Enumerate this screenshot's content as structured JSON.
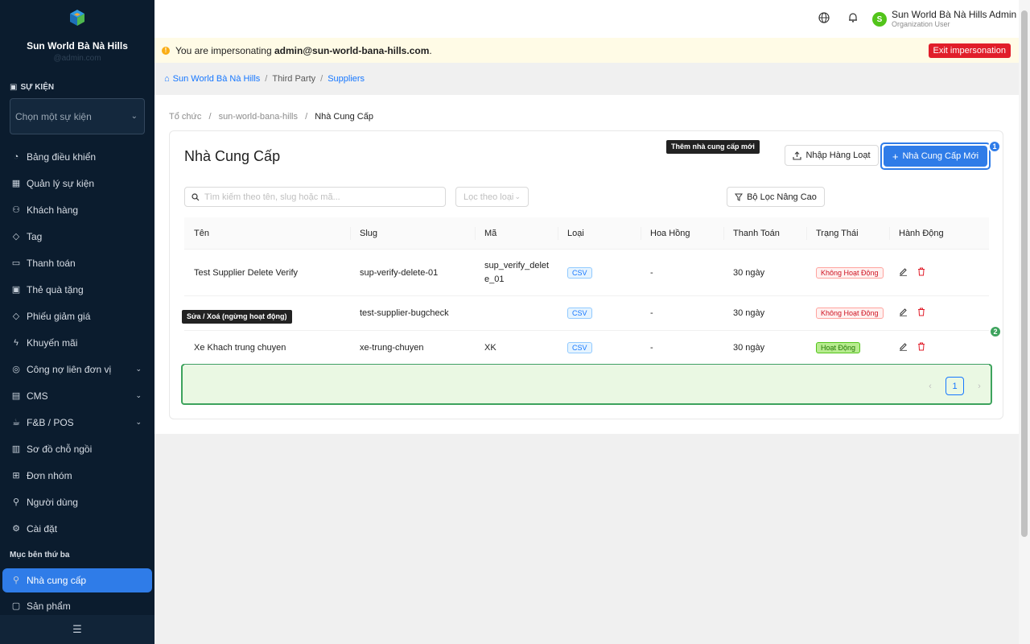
{
  "sidebar": {
    "brand_name": "Sun World Bà Nà Hills",
    "brand_sub": "@admin.com",
    "event_section": "SỰ KIỆN",
    "event_select": "Chọn một sự kiện",
    "items": [
      {
        "label": "Bảng điều khiển",
        "icon": "dashboard-icon",
        "glyph": "◔"
      },
      {
        "label": "Quản lý sự kiện",
        "icon": "calendar-icon",
        "glyph": "▦"
      },
      {
        "label": "Khách hàng",
        "icon": "users-icon",
        "glyph": "⚇"
      },
      {
        "label": "Tag",
        "icon": "tag-icon",
        "glyph": "◇"
      },
      {
        "label": "Thanh toán",
        "icon": "payment-icon",
        "glyph": "▭"
      },
      {
        "label": "Thẻ quà tặng",
        "icon": "gift-icon",
        "glyph": "▣"
      },
      {
        "label": "Phiếu giảm giá",
        "icon": "coupon-icon",
        "glyph": "◇"
      },
      {
        "label": "Khuyến mãi",
        "icon": "promotion-icon",
        "glyph": "ϟ"
      },
      {
        "label": "Công nợ liên đơn vị",
        "icon": "debt-icon",
        "glyph": "◎",
        "chevron": "⌄"
      },
      {
        "label": "CMS",
        "icon": "cms-icon",
        "glyph": "▤",
        "chevron": "⌄"
      },
      {
        "label": "F&B / POS",
        "icon": "fnb-icon",
        "glyph": "☕",
        "chevron": "⌄"
      },
      {
        "label": "Sơ đồ chỗ ngồi",
        "icon": "seatmap-icon",
        "glyph": "▥"
      },
      {
        "label": "Đơn nhóm",
        "icon": "group-order-icon",
        "glyph": "⊞"
      },
      {
        "label": "Người dùng",
        "icon": "user-icon",
        "glyph": "⚲"
      },
      {
        "label": "Cài đặt",
        "icon": "settings-icon",
        "glyph": "⚙"
      }
    ],
    "third_party_section": "Mục bên thứ ba",
    "third_party_items": [
      {
        "label": "Nhà cung cấp",
        "icon": "supplier-icon",
        "glyph": "⚲",
        "active": true
      },
      {
        "label": "Sản phẩm",
        "icon": "product-icon",
        "glyph": "▢"
      }
    ],
    "collapse_icon": "☰"
  },
  "header": {
    "user_name": "Sun World Bà Nà Hills Admin",
    "user_role": "Organization User",
    "avatar_letter": "S"
  },
  "impersonation": {
    "prefix": "You are impersonating",
    "email": "admin@sun-world-bana-hills.com",
    "suffix": ".",
    "exit_label": "Exit impersonation"
  },
  "top_breadcrumb": {
    "home": "Sun World Bà Nà Hills",
    "middle": "Third Party",
    "current": "Suppliers"
  },
  "page_breadcrumb": {
    "org": "Tổ chức",
    "slug": "sun-world-bana-hills",
    "current": "Nhà Cung Cấp"
  },
  "card": {
    "title": "Nhà Cung Cấp",
    "import_label": "Nhập Hàng Loạt",
    "new_label": "Nhà Cung Cấp Mới",
    "search_placeholder": "Tìm kiếm theo tên, slug hoặc mã...",
    "type_filter_placeholder": "Lọc theo loại",
    "advanced_filter_label": "Bộ Lọc Nâng Cao"
  },
  "annotations": {
    "tooltip_new": "Thêm nhà cung cấp mới",
    "tooltip_row": "Sửa / Xoá (ngừng hoạt động)",
    "badge_1": "1",
    "badge_2": "2"
  },
  "table": {
    "columns": [
      "Tên",
      "Slug",
      "Mã",
      "Loại",
      "Hoa Hồng",
      "Thanh Toán",
      "Trạng Thái",
      "Hành Động"
    ],
    "rows": [
      {
        "name": "Test Supplier Delete Verify",
        "slug": "sup-verify-delete-01",
        "code": "sup_verify_delete_01",
        "code_line1": "sup_verify_delet",
        "code_line2": "e_01",
        "type": "CSV",
        "commission": "-",
        "payment": "30 ngày",
        "status": "Không Hoạt Động",
        "status_kind": "inactive"
      },
      {
        "name": "",
        "slug": "test-supplier-bugcheck",
        "code": "",
        "type": "CSV",
        "commission": "-",
        "payment": "30 ngày",
        "status": "Không Hoạt Động",
        "status_kind": "inactive"
      },
      {
        "name": "Xe Khach trung chuyen",
        "slug": "xe-trung-chuyen",
        "code": "XK",
        "type": "CSV",
        "commission": "-",
        "payment": "30 ngày",
        "status": "Hoạt Động",
        "status_kind": "active"
      }
    ]
  },
  "pagination": {
    "current": "1",
    "prev": "‹",
    "next": "›"
  },
  "colors": {
    "primary": "#2f7ce8",
    "sidebar_bg": "#0b1c2e",
    "danger": "#e11d2a",
    "success": "#3da35d"
  }
}
